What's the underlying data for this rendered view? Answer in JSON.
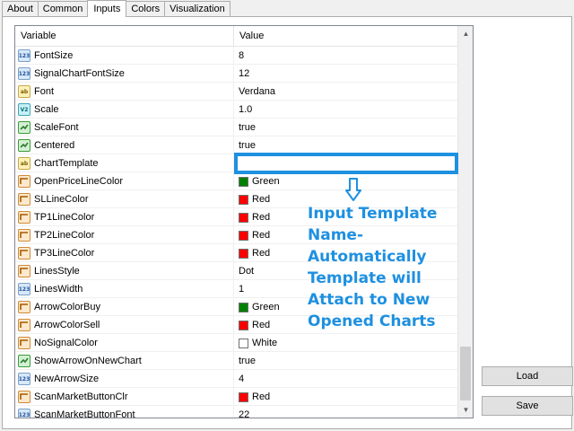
{
  "tabs": [
    {
      "label": "About"
    },
    {
      "label": "Common"
    },
    {
      "label": "Inputs"
    },
    {
      "label": "Colors"
    },
    {
      "label": "Visualization"
    }
  ],
  "active_tab": "Inputs",
  "grid": {
    "header": {
      "variable": "Variable",
      "value": "Value"
    },
    "rows": [
      {
        "variable": "FontSize",
        "value": "8",
        "type_icon": "int-icon"
      },
      {
        "variable": "SignalChartFontSize",
        "value": "12",
        "type_icon": "int-icon"
      },
      {
        "variable": "Font",
        "value": "Verdana",
        "type_icon": "string-icon"
      },
      {
        "variable": "Scale",
        "value": "1.0",
        "type_icon": "double-icon"
      },
      {
        "variable": "ScaleFont",
        "value": "true",
        "type_icon": "bool-icon"
      },
      {
        "variable": "Centered",
        "value": "true",
        "type_icon": "bool-icon"
      },
      {
        "variable": "ChartTemplate",
        "value": "",
        "type_icon": "string-icon"
      },
      {
        "variable": "OpenPriceLineColor",
        "value": "Green",
        "type_icon": "color-icon",
        "swatch": "#008000"
      },
      {
        "variable": "SLLineColor",
        "value": "Red",
        "type_icon": "color-icon",
        "swatch": "#ff0000"
      },
      {
        "variable": "TP1LineColor",
        "value": "Red",
        "type_icon": "color-icon",
        "swatch": "#ff0000"
      },
      {
        "variable": "TP2LineColor",
        "value": "Red",
        "type_icon": "color-icon",
        "swatch": "#ff0000"
      },
      {
        "variable": "TP3LineColor",
        "value": "Red",
        "type_icon": "color-icon",
        "swatch": "#ff0000"
      },
      {
        "variable": "LinesStyle",
        "value": "Dot",
        "type_icon": "color-icon"
      },
      {
        "variable": "LinesWidth",
        "value": "1",
        "type_icon": "int-icon"
      },
      {
        "variable": "ArrowColorBuy",
        "value": "Green",
        "type_icon": "color-icon",
        "swatch": "#008000"
      },
      {
        "variable": "ArrowColorSell",
        "value": "Red",
        "type_icon": "color-icon",
        "swatch": "#ff0000"
      },
      {
        "variable": "NoSignalColor",
        "value": "White",
        "type_icon": "color-icon",
        "swatch": "#ffffff"
      },
      {
        "variable": "ShowArrowOnNewChart",
        "value": "true",
        "type_icon": "bool-icon"
      },
      {
        "variable": "NewArrowSize",
        "value": "4",
        "type_icon": "int-icon"
      },
      {
        "variable": "ScanMarketButtonClr",
        "value": "Red",
        "type_icon": "color-icon",
        "swatch": "#ff0000"
      },
      {
        "variable": "ScanMarketButtonFont",
        "value": "22",
        "type_icon": "int-icon"
      }
    ]
  },
  "annotation": {
    "lines": [
      "Input Template",
      "Name-",
      "Automatically",
      "Template will",
      "Attach to New",
      "Opened Charts"
    ],
    "color": "#1e90e0"
  },
  "buttons": {
    "load": "Load",
    "save": "Save"
  },
  "type_icon_glyphs": {
    "int": "123",
    "string": "ab",
    "double": "V2"
  }
}
